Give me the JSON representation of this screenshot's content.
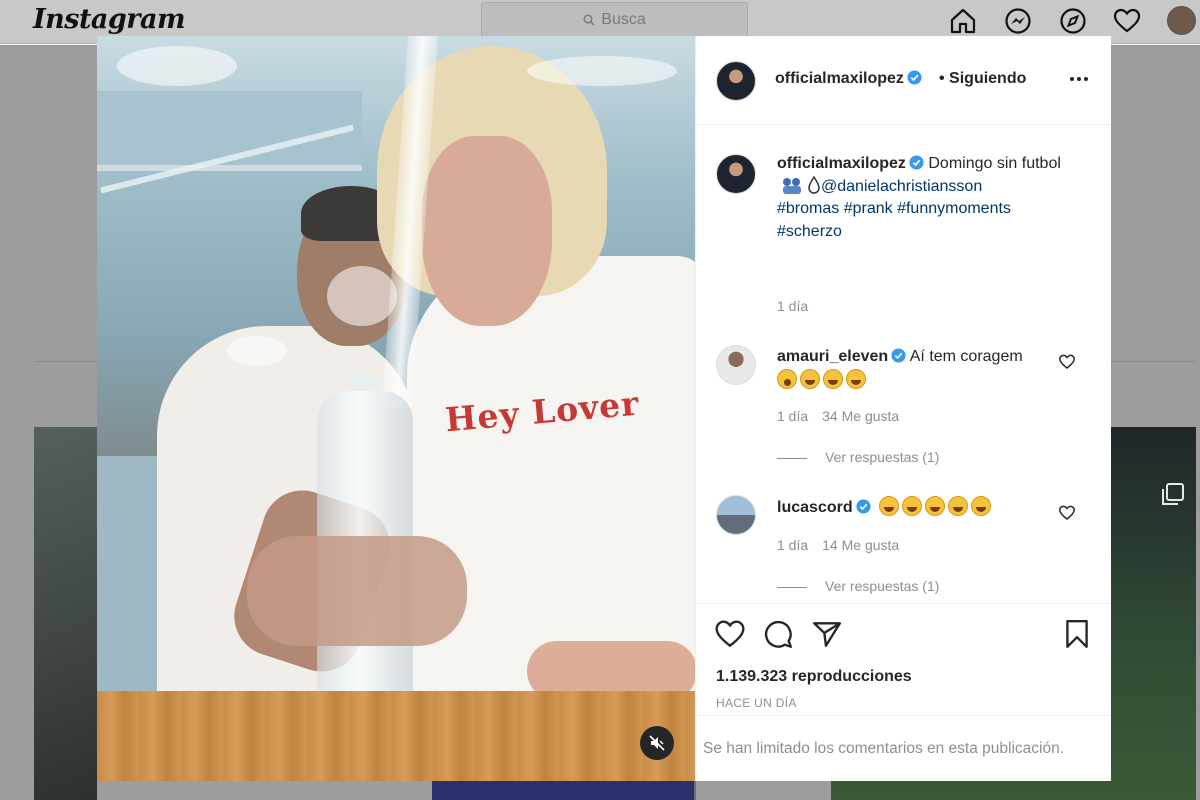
{
  "app": {
    "logo_text": "Instagram"
  },
  "search": {
    "placeholder": "Busca",
    "icon": "search-icon"
  },
  "nav": {
    "icons": [
      "home-icon",
      "messenger-icon",
      "explore-icon",
      "heart-icon",
      "profile-avatar"
    ]
  },
  "post": {
    "username": "officialmaxilopez",
    "verified": true,
    "follow_status": "• Siguiendo",
    "caption_user": "officialmaxilopez",
    "caption_text": "Domingo sin futbol",
    "caption_mention": "@danielachristiansson",
    "hashtags": [
      "#bromas",
      "#prank",
      "#funnymoments",
      "#scherzo"
    ],
    "caption_time": "1 día",
    "shirt_text": "Hey Lover",
    "views": "1.139.323 reproducciones",
    "posted": "HACE UN DÍA",
    "comments_limited": "Se han limitado los comentarios en esta publicación."
  },
  "comments": [
    {
      "user": "amauri_eleven",
      "text": "Aí tem coragem",
      "emojis": [
        "astonished-emoji",
        "laughing-emoji",
        "laughing-emoji",
        "laughing-emoji"
      ],
      "time": "1 día",
      "likes": "34 Me gusta",
      "replies": "Ver respuestas (1)"
    },
    {
      "user": "lucascord",
      "text": "",
      "emojis": [
        "laughing-emoji",
        "laughing-emoji",
        "laughing-emoji",
        "laughing-emoji",
        "laughing-emoji"
      ],
      "time": "1 día",
      "likes": "14 Me gusta",
      "replies": "Ver respuestas (1)"
    }
  ],
  "colors": {
    "verified": "#3897f0",
    "link": "#00376b",
    "secondary_text": "#8e8e8e",
    "shirt_text": "#c53a36"
  }
}
